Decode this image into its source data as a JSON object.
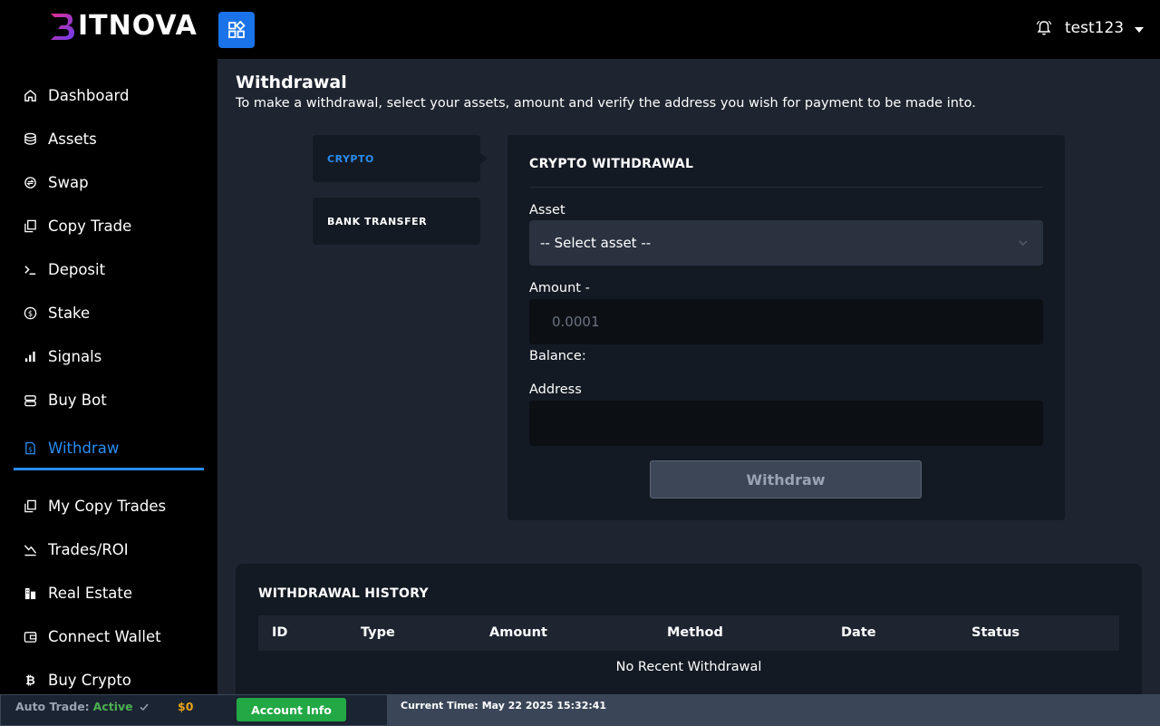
{
  "brand": {
    "logo_text": "ITNOVA"
  },
  "sidebar": {
    "items": [
      {
        "label": "Dashboard",
        "icon": "home-icon"
      },
      {
        "label": "Assets",
        "icon": "database-icon"
      },
      {
        "label": "Swap",
        "icon": "swap-icon"
      },
      {
        "label": "Copy Trade",
        "icon": "copy-icon"
      },
      {
        "label": "Deposit",
        "icon": "deposit-icon"
      },
      {
        "label": "Stake",
        "icon": "dollar-circle-icon"
      },
      {
        "label": "Signals",
        "icon": "signal-bars-icon"
      },
      {
        "label": "Buy Bot",
        "icon": "bot-icon"
      },
      {
        "label": "Withdraw",
        "icon": "document-dollar-icon",
        "active": true
      },
      {
        "label": "My Copy Trades",
        "icon": "copy-icon"
      },
      {
        "label": "Trades/ROI",
        "icon": "chart-icon"
      },
      {
        "label": "Real Estate",
        "icon": "building-icon"
      },
      {
        "label": "Connect Wallet",
        "icon": "wallet-icon"
      },
      {
        "label": "Buy Crypto",
        "icon": "bitcoin-icon"
      }
    ]
  },
  "header": {
    "username": "test123"
  },
  "page": {
    "title": "Withdrawal",
    "subtitle": "To make a withdrawal, select your assets, amount and verify the address you wish for payment to be made into."
  },
  "tabs": [
    {
      "label": "CRYPTO",
      "active": true
    },
    {
      "label": "BANK TRANSFER",
      "active": false
    }
  ],
  "form": {
    "title": "CRYPTO WITHDRAWAL",
    "asset_label": "Asset",
    "asset_value": "-- Select asset --",
    "amount_label": "Amount -",
    "amount_placeholder": "0.0001",
    "balance_label": "Balance:",
    "address_label": "Address",
    "address_value": "",
    "submit_label": "Withdraw"
  },
  "history": {
    "title": "WITHDRAWAL HISTORY",
    "columns": [
      "ID",
      "Type",
      "Amount",
      "Method",
      "Date",
      "Status"
    ],
    "empty_text": "No Recent Withdrawal"
  },
  "footer": {
    "auto_trade_label": "Auto Trade:",
    "auto_trade_status": "Active",
    "balance": "$0",
    "account_button": "Account Info",
    "time_label": "Current Time:",
    "time_value": "May 22 2025 15:32:41"
  },
  "colors": {
    "accent": "#2a8cf0",
    "active_green": "#4caf50",
    "balance_gold": "#e8a317",
    "account_button": "#22a845"
  }
}
